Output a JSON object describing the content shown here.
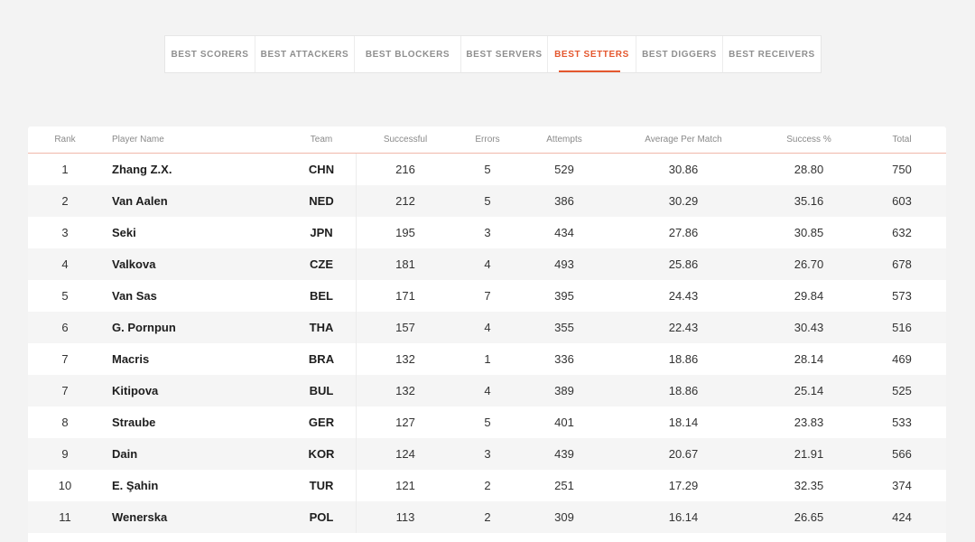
{
  "tabs": [
    {
      "label": "BEST SCORERS",
      "active": false
    },
    {
      "label": "BEST ATTACKERS",
      "active": false
    },
    {
      "label": "BEST BLOCKERS",
      "active": false
    },
    {
      "label": "BEST SERVERS",
      "active": false
    },
    {
      "label": "BEST SETTERS",
      "active": true
    },
    {
      "label": "BEST DIGGERS",
      "active": false
    },
    {
      "label": "BEST RECEIVERS",
      "active": false
    }
  ],
  "accent_color": "#e4572e",
  "table": {
    "headers": {
      "rank": "Rank",
      "name": "Player Name",
      "team": "Team",
      "successful": "Successful",
      "errors": "Errors",
      "attempts": "Attempts",
      "average": "Average Per Match",
      "success_pct": "Success %",
      "total": "Total"
    },
    "rows": [
      {
        "rank": "1",
        "name": "Zhang Z.X.",
        "team": "CHN",
        "successful": "216",
        "errors": "5",
        "attempts": "529",
        "average": "30.86",
        "success_pct": "28.80",
        "total": "750"
      },
      {
        "rank": "2",
        "name": "Van Aalen",
        "team": "NED",
        "successful": "212",
        "errors": "5",
        "attempts": "386",
        "average": "30.29",
        "success_pct": "35.16",
        "total": "603"
      },
      {
        "rank": "3",
        "name": "Seki",
        "team": "JPN",
        "successful": "195",
        "errors": "3",
        "attempts": "434",
        "average": "27.86",
        "success_pct": "30.85",
        "total": "632"
      },
      {
        "rank": "4",
        "name": "Valkova",
        "team": "CZE",
        "successful": "181",
        "errors": "4",
        "attempts": "493",
        "average": "25.86",
        "success_pct": "26.70",
        "total": "678"
      },
      {
        "rank": "5",
        "name": "Van Sas",
        "team": "BEL",
        "successful": "171",
        "errors": "7",
        "attempts": "395",
        "average": "24.43",
        "success_pct": "29.84",
        "total": "573"
      },
      {
        "rank": "6",
        "name": "G. Pornpun",
        "team": "THA",
        "successful": "157",
        "errors": "4",
        "attempts": "355",
        "average": "22.43",
        "success_pct": "30.43",
        "total": "516"
      },
      {
        "rank": "7",
        "name": "Macris",
        "team": "BRA",
        "successful": "132",
        "errors": "1",
        "attempts": "336",
        "average": "18.86",
        "success_pct": "28.14",
        "total": "469"
      },
      {
        "rank": "7",
        "name": "Kitipova",
        "team": "BUL",
        "successful": "132",
        "errors": "4",
        "attempts": "389",
        "average": "18.86",
        "success_pct": "25.14",
        "total": "525"
      },
      {
        "rank": "8",
        "name": "Straube",
        "team": "GER",
        "successful": "127",
        "errors": "5",
        "attempts": "401",
        "average": "18.14",
        "success_pct": "23.83",
        "total": "533"
      },
      {
        "rank": "9",
        "name": "Dain",
        "team": "KOR",
        "successful": "124",
        "errors": "3",
        "attempts": "439",
        "average": "20.67",
        "success_pct": "21.91",
        "total": "566"
      },
      {
        "rank": "10",
        "name": "E. Şahin",
        "team": "TUR",
        "successful": "121",
        "errors": "2",
        "attempts": "251",
        "average": "17.29",
        "success_pct": "32.35",
        "total": "374"
      },
      {
        "rank": "11",
        "name": "Wenerska",
        "team": "POL",
        "successful": "113",
        "errors": "2",
        "attempts": "309",
        "average": "16.14",
        "success_pct": "26.65",
        "total": "424"
      }
    ]
  }
}
